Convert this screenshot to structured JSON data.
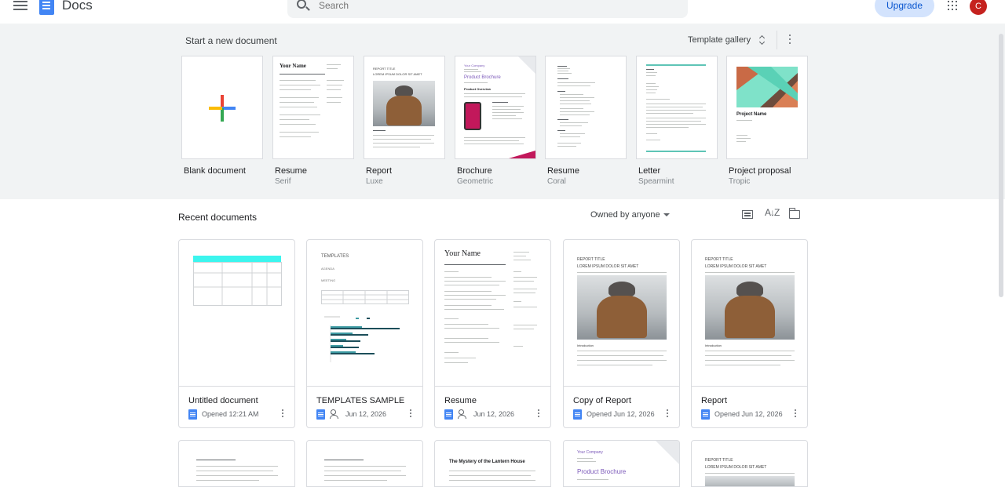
{
  "header": {
    "menu_icon": "hamburger-menu-icon",
    "app_name": "Docs",
    "search_placeholder": "Search",
    "upgrade_label": "Upgrade",
    "apps_icon": "google-apps-grid-icon",
    "avatar_letter": "C",
    "avatar_color": "#c5221f"
  },
  "templates": {
    "title": "Start a new document",
    "gallery_label": "Template gallery",
    "items": [
      {
        "name": "Blank document",
        "style": ""
      },
      {
        "name": "Resume",
        "style": "Serif"
      },
      {
        "name": "Report",
        "style": "Luxe"
      },
      {
        "name": "Brochure",
        "style": "Geometric"
      },
      {
        "name": "Resume",
        "style": "Coral"
      },
      {
        "name": "Letter",
        "style": "Spearmint"
      },
      {
        "name": "Project proposal",
        "style": "Tropic"
      }
    ],
    "thumb_text": {
      "resume_name": "Your Name",
      "report_title": "REPORT TITLE",
      "report_subtitle": "LOREM IPSUM DOLOR SIT AMET",
      "brochure_company": "Your Company",
      "brochure_title": "Product Brochure",
      "brochure_overview": "Product Overview",
      "proposal_title": "Project Name"
    }
  },
  "recent": {
    "title": "Recent documents",
    "owner_filter": "Owned by anyone",
    "documents": [
      {
        "name": "Untitled document",
        "opened": "Opened 12:21 AM",
        "shared": false
      },
      {
        "name": "TEMPLATES SAMPLE",
        "opened": "Jun 12, 2026",
        "shared": true
      },
      {
        "name": "Resume",
        "opened": "Jun 12, 2026",
        "shared": true
      },
      {
        "name": "Copy of Report",
        "opened": "Opened Jun 12, 2026",
        "shared": false
      },
      {
        "name": "Report",
        "opened": "Opened Jun 12, 2026",
        "shared": false
      }
    ],
    "thumb_text": {
      "templates": "TEMPLATES",
      "agenda": "AGENDA",
      "meeting": "MEETING",
      "resume_name": "Your Name",
      "report_title": "REPORT TITLE",
      "report_subtitle": "LOREM IPSUM DOLOR SIT AMET",
      "introduction": "Introduction",
      "lantern": "The Mystery of the Lantern House",
      "company": "Your Company",
      "brochure": "Product Brochure"
    }
  },
  "colors": {
    "accent_blue": "#4285f4",
    "upgrade_bg": "#d3e3fd",
    "section_bg": "#f1f3f4"
  }
}
